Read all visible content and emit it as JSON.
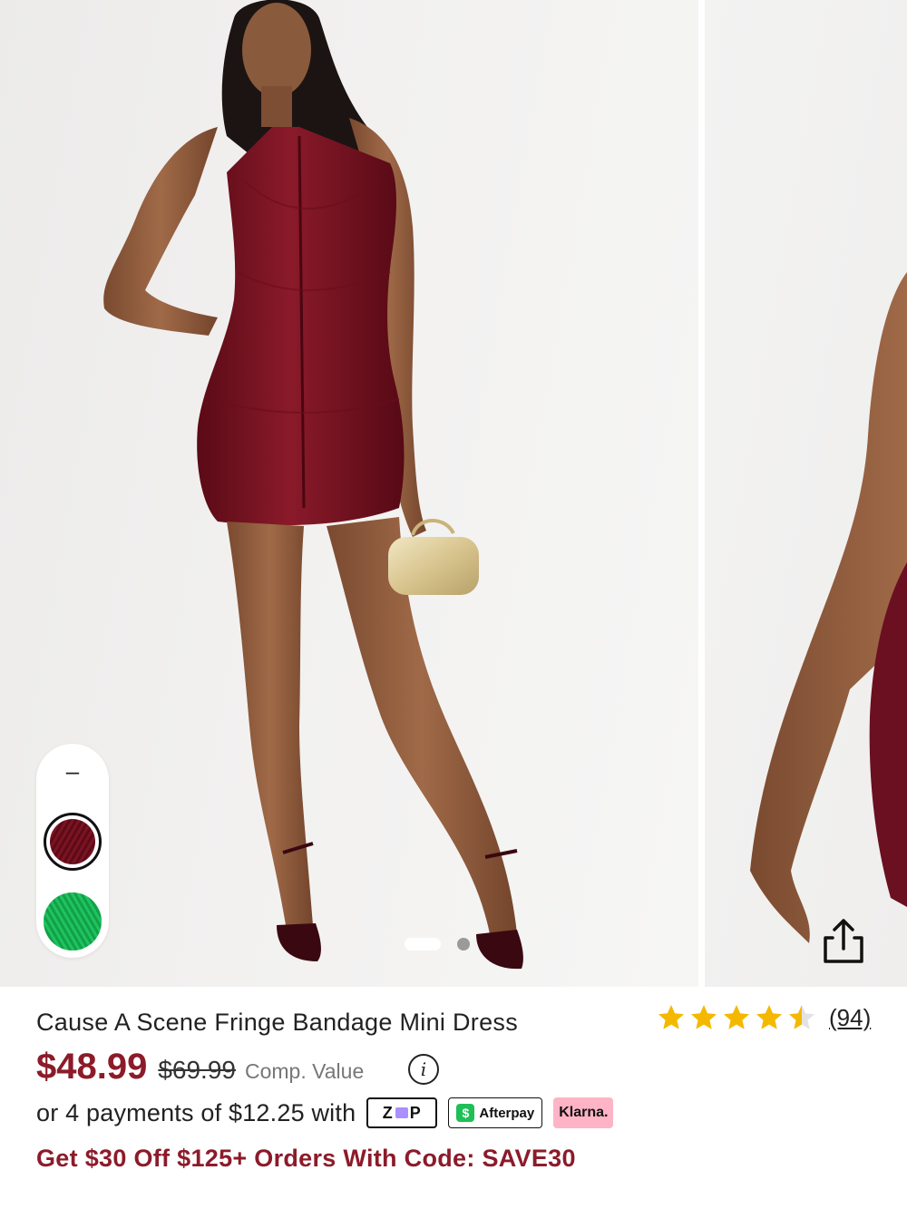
{
  "gallery": {
    "swatch_collapse_symbol": "–",
    "swatches": [
      {
        "name": "burgundy",
        "color": "#6b0f1d",
        "selected": true
      },
      {
        "name": "green",
        "color": "#18b153",
        "selected": false
      }
    ],
    "slide_count": 2,
    "active_slide": 1,
    "share_icon": "share-icon"
  },
  "product": {
    "title": "Cause A Scene Fringe Bandage Mini Dress",
    "rating": 4.5,
    "rating_max": 5,
    "review_count": "(94)",
    "price": "$48.99",
    "original_price": "$69.99",
    "comp_value_label": "Comp. Value",
    "info_symbol": "i",
    "installment_text": "or 4 payments of $12.25 with",
    "payment_providers": {
      "zip": "ZIP",
      "afterpay": "Afterpay",
      "afterpay_symbol": "$",
      "klarna": "Klarna."
    },
    "promo_text": "Get $30 Off $125+ Orders With Code: SAVE30"
  },
  "colors": {
    "price": "#8c1b2a",
    "promo": "#8c1b2a",
    "star": "#f5b800",
    "dress": "#7a1423"
  }
}
